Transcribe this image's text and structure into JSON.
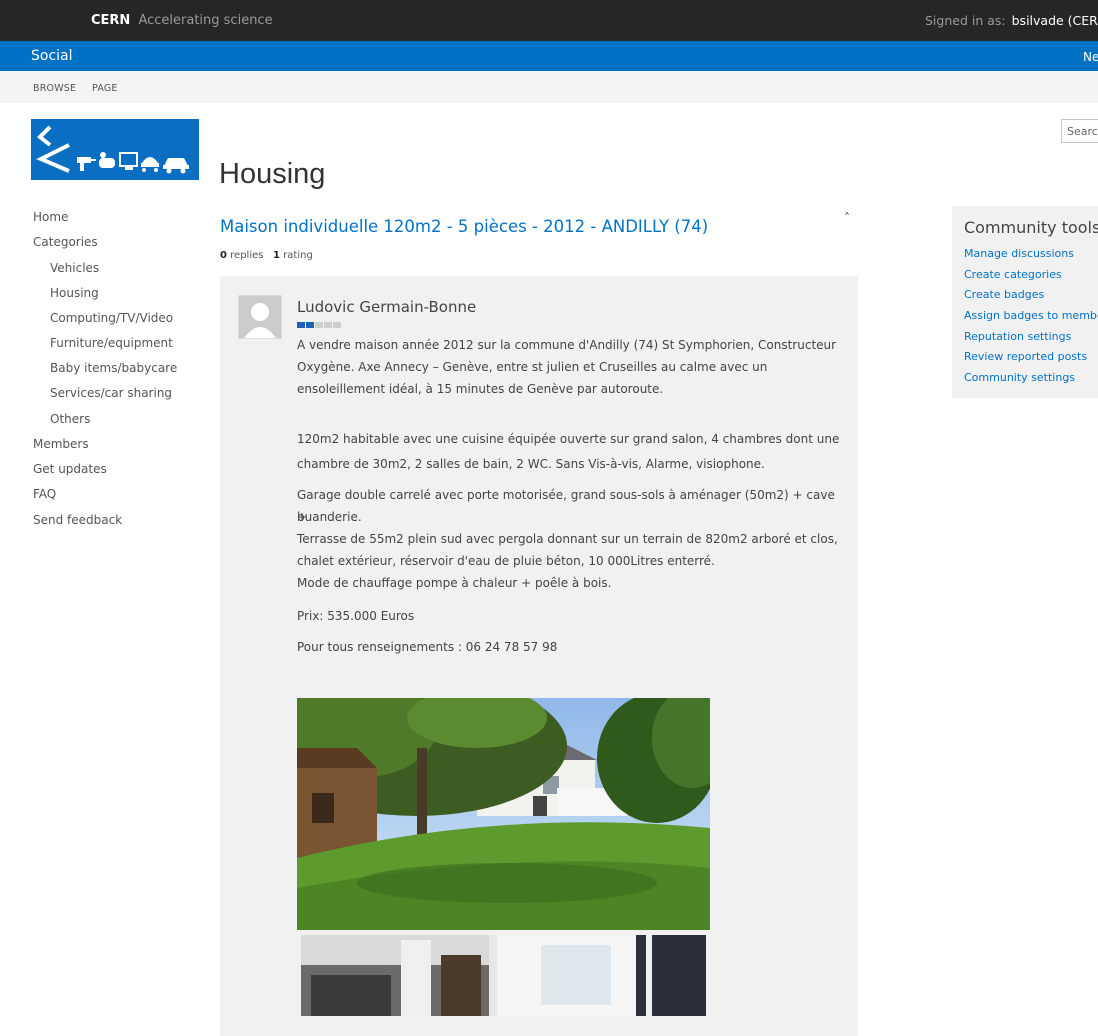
{
  "topbar": {
    "brand": "CERN",
    "tagline": "Accelerating science",
    "signed_in_label": "Signed in as:",
    "user": "bsilvade (CERN"
  },
  "sitebar": {
    "title": "Social",
    "right_text": "Ne"
  },
  "ribbon": {
    "tabs": [
      "BROWSE",
      "PAGE"
    ]
  },
  "search": {
    "placeholder": "Search"
  },
  "page": {
    "title": "Housing"
  },
  "nav": {
    "items": [
      {
        "label": "Home"
      },
      {
        "label": "Categories"
      },
      {
        "label": "Vehicles"
      },
      {
        "label": "Housing"
      },
      {
        "label": "Computing/TV/Video"
      },
      {
        "label": "Furniture/equipment"
      },
      {
        "label": "Baby items/babycare"
      },
      {
        "label": "Services/car sharing"
      },
      {
        "label": "Others"
      },
      {
        "label": "Members"
      },
      {
        "label": "Get updates"
      },
      {
        "label": "FAQ"
      },
      {
        "label": "Send feedback"
      }
    ]
  },
  "discussion": {
    "title": "Maison individuelle 120m2 - 5 pièces - 2012 - ANDILLY (74)",
    "collapse_glyph": "˄",
    "replies_count": "0",
    "replies_label": "replies",
    "rating_count": "1",
    "rating_label": "rating"
  },
  "post": {
    "author": "Ludovic Germain-Bonne",
    "lines": [
      "A vendre maison année 2012 sur la commune d'Andilly (74) St Symphorien, Constructeur",
      "Oxygène.  Axe Annecy – Genève,  entre st julien et Cruseilles au calme avec un",
      "ensoleillement idéal, à 15 minutes de Genève par autoroute.",
      "120m2 habitable avec une cuisine équipée ouverte sur grand salon, 4 chambres dont une",
      "chambre de 30m2, 2 salles de bain, 2 WC. Sans Vis-à-vis, Alarme, visiophone.",
      "Garage double carrelé avec porte motorisée, grand sous-sols à aménager (50m2) + cave +",
      "buanderie.",
      "Terrasse de 55m2 plein sud avec pergola donnant sur un terrain de 820m2 arboré et clos,",
      "chalet extérieur, réservoir d'eau de pluie béton, 10 000Litres enterré.",
      "Mode de chauffage pompe à chaleur + poêle à bois.",
      "Prix: 535.000 Euros",
      "Pour tous renseignements : 06 24 78 57 98"
    ]
  },
  "community_tools": {
    "title": "Community tools",
    "links": [
      {
        "label": "Manage discussions"
      },
      {
        "label": "Create categories"
      },
      {
        "label": "Create badges"
      },
      {
        "label": "Assign badges to membe"
      },
      {
        "label": "Reputation settings"
      },
      {
        "label": "Review reported posts"
      },
      {
        "label": "Community settings"
      }
    ]
  },
  "colors": {
    "accent": "#0072c6",
    "topbar": "#262626",
    "panel": "#f1f1f1"
  }
}
